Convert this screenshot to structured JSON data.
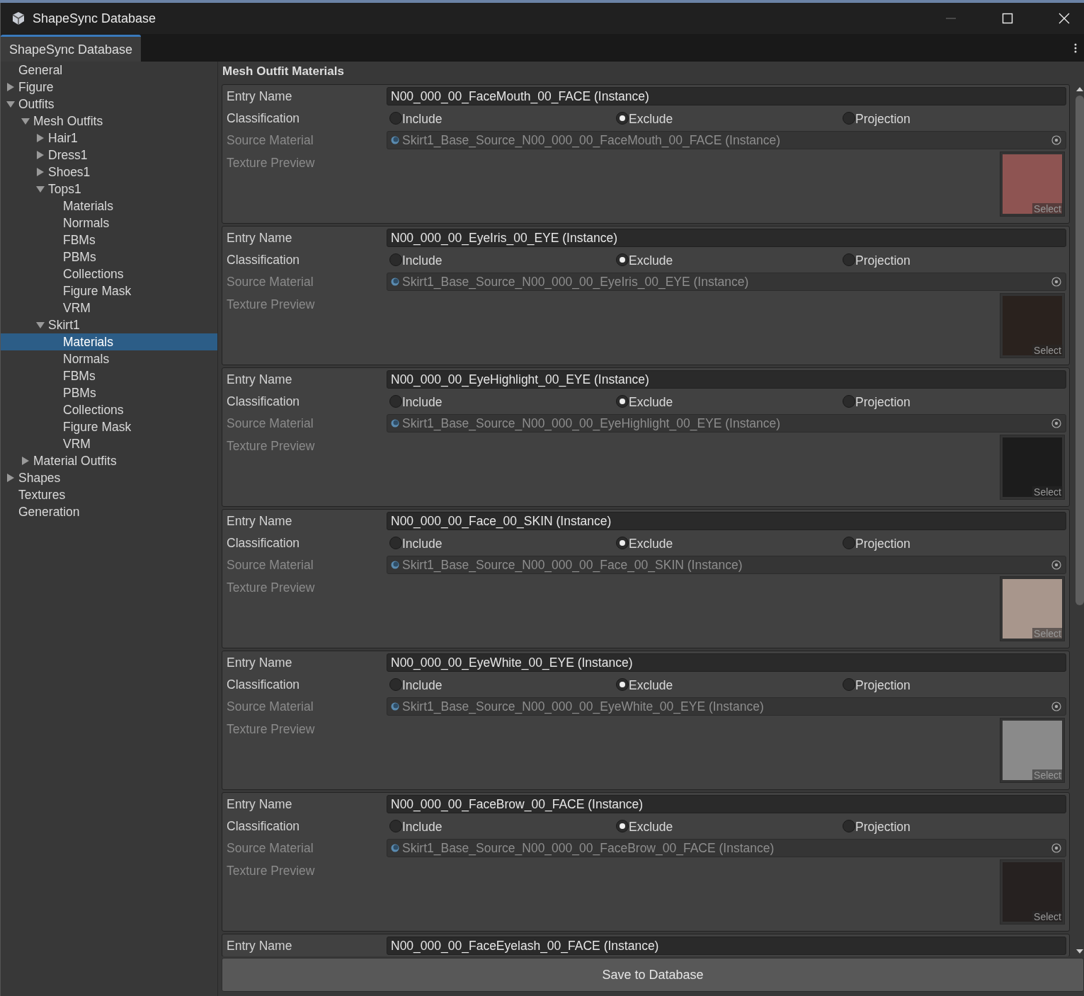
{
  "window": {
    "title": "ShapeSync Database"
  },
  "tabs": [
    {
      "label": "ShapeSync Database",
      "selected": true
    }
  ],
  "sidebar": {
    "items": [
      {
        "label": "General",
        "selected": false
      },
      {
        "label": "Figure",
        "selected": false,
        "expanded": false
      },
      {
        "label": "Outfits",
        "selected": false,
        "expanded": true,
        "children": [
          {
            "label": "Mesh Outfits",
            "selected": false,
            "expanded": true,
            "children": [
              {
                "label": "Hair1",
                "selected": false,
                "expanded": false
              },
              {
                "label": "Dress1",
                "selected": false,
                "expanded": false
              },
              {
                "label": "Shoes1",
                "selected": false,
                "expanded": false
              },
              {
                "label": "Tops1",
                "selected": false,
                "expanded": true,
                "children": [
                  {
                    "label": "Materials",
                    "selected": false
                  },
                  {
                    "label": "Normals",
                    "selected": false
                  },
                  {
                    "label": "FBMs",
                    "selected": false
                  },
                  {
                    "label": "PBMs",
                    "selected": false
                  },
                  {
                    "label": "Collections",
                    "selected": false
                  },
                  {
                    "label": "Figure Mask",
                    "selected": false
                  },
                  {
                    "label": "VRM",
                    "selected": false
                  }
                ]
              },
              {
                "label": "Skirt1",
                "selected": false,
                "expanded": true,
                "children": [
                  {
                    "label": "Materials",
                    "selected": true
                  },
                  {
                    "label": "Normals",
                    "selected": false
                  },
                  {
                    "label": "FBMs",
                    "selected": false
                  },
                  {
                    "label": "PBMs",
                    "selected": false
                  },
                  {
                    "label": "Collections",
                    "selected": false
                  },
                  {
                    "label": "Figure Mask",
                    "selected": false
                  },
                  {
                    "label": "VRM",
                    "selected": false
                  }
                ]
              }
            ]
          },
          {
            "label": "Material Outfits",
            "selected": false,
            "expanded": false
          }
        ]
      },
      {
        "label": "Shapes",
        "selected": false,
        "expanded": false
      },
      {
        "label": "Textures",
        "selected": false
      },
      {
        "label": "Generation",
        "selected": false
      }
    ]
  },
  "panel": {
    "title": "Mesh Outfit Materials",
    "entries": [
      {
        "entry_name_label": "Entry Name",
        "entry_name": "N00_000_00_FaceMouth_00_FACE (Instance)",
        "classification_label": "Classification",
        "options": [
          {
            "label": "Include",
            "selected": false
          },
          {
            "label": "Exclude",
            "selected": true
          },
          {
            "label": "Projection",
            "selected": false
          }
        ],
        "source_label": "Source Material",
        "source": "Skirt1_Base_Source_N00_000_00_FaceMouth_00_FACE (Instance)",
        "preview_label": "Texture Preview",
        "select_label": "Select",
        "preview": {
          "color": "#8e5452"
        }
      },
      {
        "entry_name_label": "Entry Name",
        "entry_name": "N00_000_00_EyeIris_00_EYE (Instance)",
        "classification_label": "Classification",
        "options": [
          {
            "label": "Include",
            "selected": false
          },
          {
            "label": "Exclude",
            "selected": true
          },
          {
            "label": "Projection",
            "selected": false
          }
        ],
        "source_label": "Source Material",
        "source": "Skirt1_Base_Source_N00_000_00_EyeIris_00_EYE (Instance)",
        "preview_label": "Texture Preview",
        "select_label": "Select",
        "preview": {
          "color": "#2a221e"
        }
      },
      {
        "entry_name_label": "Entry Name",
        "entry_name": "N00_000_00_EyeHighlight_00_EYE (Instance)",
        "classification_label": "Classification",
        "options": [
          {
            "label": "Include",
            "selected": false
          },
          {
            "label": "Exclude",
            "selected": true
          },
          {
            "label": "Projection",
            "selected": false
          }
        ],
        "source_label": "Source Material",
        "source": "Skirt1_Base_Source_N00_000_00_EyeHighlight_00_EYE (Instance)",
        "preview_label": "Texture Preview",
        "select_label": "Select",
        "preview": {
          "color": "#1c1c1c"
        }
      },
      {
        "entry_name_label": "Entry Name",
        "entry_name": "N00_000_00_Face_00_SKIN (Instance)",
        "classification_label": "Classification",
        "options": [
          {
            "label": "Include",
            "selected": false
          },
          {
            "label": "Exclude",
            "selected": true
          },
          {
            "label": "Projection",
            "selected": false
          }
        ],
        "source_label": "Source Material",
        "source": "Skirt1_Base_Source_N00_000_00_Face_00_SKIN (Instance)",
        "preview_label": "Texture Preview",
        "select_label": "Select",
        "preview": {
          "color": "#a8968c"
        }
      },
      {
        "entry_name_label": "Entry Name",
        "entry_name": "N00_000_00_EyeWhite_00_EYE (Instance)",
        "classification_label": "Classification",
        "options": [
          {
            "label": "Include",
            "selected": false
          },
          {
            "label": "Exclude",
            "selected": true
          },
          {
            "label": "Projection",
            "selected": false
          }
        ],
        "source_label": "Source Material",
        "source": "Skirt1_Base_Source_N00_000_00_EyeWhite_00_EYE (Instance)",
        "preview_label": "Texture Preview",
        "select_label": "Select",
        "preview": {
          "color": "#8a8a8a"
        }
      },
      {
        "entry_name_label": "Entry Name",
        "entry_name": "N00_000_00_FaceBrow_00_FACE (Instance)",
        "classification_label": "Classification",
        "options": [
          {
            "label": "Include",
            "selected": false
          },
          {
            "label": "Exclude",
            "selected": true
          },
          {
            "label": "Projection",
            "selected": false
          }
        ],
        "source_label": "Source Material",
        "source": "Skirt1_Base_Source_N00_000_00_FaceBrow_00_FACE (Instance)",
        "preview_label": "Texture Preview",
        "select_label": "Select",
        "preview": {
          "color": "#262120"
        }
      },
      {
        "entry_name_label": "Entry Name",
        "entry_name": "N00_000_00_FaceEyelash_00_FACE (Instance)"
      }
    ],
    "save_button": "Save to Database"
  }
}
